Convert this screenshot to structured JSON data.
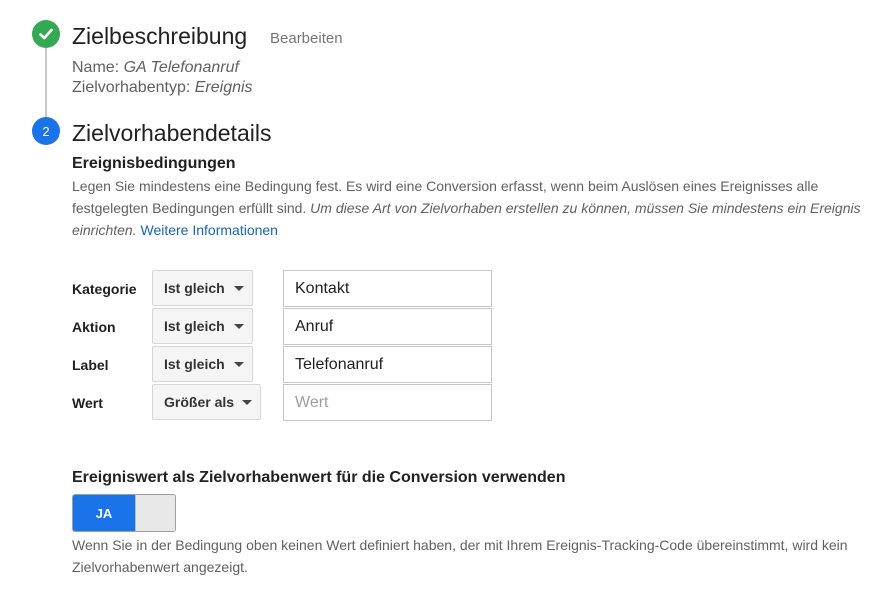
{
  "step1": {
    "title": "Zielbeschreibung",
    "edit_label": "Bearbeiten",
    "name_label": "Name:",
    "name_value": "GA Telefonanruf",
    "type_label": "Zielvorhabentyp:",
    "type_value": "Ereignis",
    "status_icon": "checkmark-icon",
    "status_color": "#34a853"
  },
  "step2": {
    "number": "2",
    "title": "Zielvorhabendetails",
    "color": "#1a73e8"
  },
  "event_conditions": {
    "heading": "Ereignisbedingungen",
    "description_line1": "Legen Sie mindestens eine Bedingung fest. Es wird eine Conversion erfasst, wenn beim Auslösen eines Ereignisses alle",
    "description_line2_plain": "festgelegten Bedingungen erfüllt sind.",
    "description_line2_italic": "Um diese Art von Zielvorhaben erstellen zu können, müssen Sie mindestens ein Ereignis",
    "description_line3_italic": "einrichten.",
    "more_info_link": "Weitere Informationen",
    "rows": [
      {
        "label": "Kategorie",
        "operator": "Ist gleich",
        "value": "Kontakt"
      },
      {
        "label": "Aktion",
        "operator": "Ist gleich",
        "value": "Anruf"
      },
      {
        "label": "Label",
        "operator": "Ist gleich",
        "value": "Telefonanruf"
      },
      {
        "label": "Wert",
        "operator": "Größer als",
        "value": "",
        "placeholder": "Wert"
      }
    ]
  },
  "event_value": {
    "heading": "Ereigniswert als Zielvorhabenwert für die Conversion verwenden",
    "toggle_label": "JA",
    "toggle_on": true,
    "hint_line1": "Wenn Sie in der Bedingung oben keinen Wert definiert haben, der mit Ihrem Ereignis-Tracking-Code übereinstimmt, wird kein",
    "hint_line2": "Zielvorhabenwert angezeigt."
  }
}
